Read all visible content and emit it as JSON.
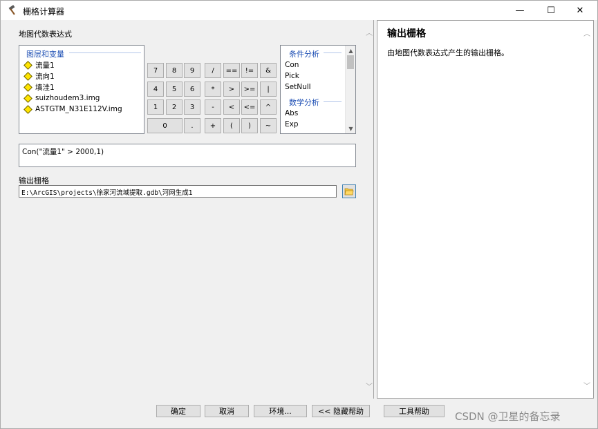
{
  "window": {
    "title": "栅格计算器",
    "icon": "hammer-icon",
    "controls": {
      "minimize": "—",
      "maximize": "☐",
      "close": "✕"
    }
  },
  "left": {
    "expression_section_label": "地图代数表达式",
    "layers_group_label": "图层和变量",
    "layers": [
      "流量1",
      "流向1",
      "填洼1",
      "suizhoudem3.img",
      "ASTGTM_N31E112V.img"
    ],
    "calc_buttons": [
      [
        "7",
        "8",
        "9",
        "/",
        "==",
        "!=",
        "&"
      ],
      [
        "4",
        "5",
        "6",
        "*",
        ">",
        ">=",
        "|"
      ],
      [
        "1",
        "2",
        "3",
        "-",
        "<",
        "<=",
        "^"
      ],
      [
        "0",
        ".",
        "+",
        "(",
        ")",
        "~"
      ]
    ],
    "conditional_group_label": "条件分析",
    "conditional_tools": [
      "Con",
      "Pick",
      "SetNull"
    ],
    "math_group_label": "数学分析",
    "math_tools": [
      "Abs",
      "Exp"
    ],
    "expression": "Con(\"流量1\" > 2000,1)",
    "output_label": "输出栅格",
    "output_path": "E:\\ArcGIS\\projects\\徐家河流域提取.gdb\\河网生成1"
  },
  "help": {
    "title": "输出栅格",
    "body": "由地图代数表达式产生的输出栅格。"
  },
  "footer": {
    "ok": "确定",
    "cancel": "取消",
    "environments": "环境...",
    "hide_help": "<< 隐藏帮助",
    "tool_help": "工具帮助"
  },
  "watermark": "CSDN @卫星的备忘录",
  "colors": {
    "group_header": "#1e4fb4",
    "layer_diamond": "#ffe400",
    "folder_button_border": "#3c7fb1"
  }
}
